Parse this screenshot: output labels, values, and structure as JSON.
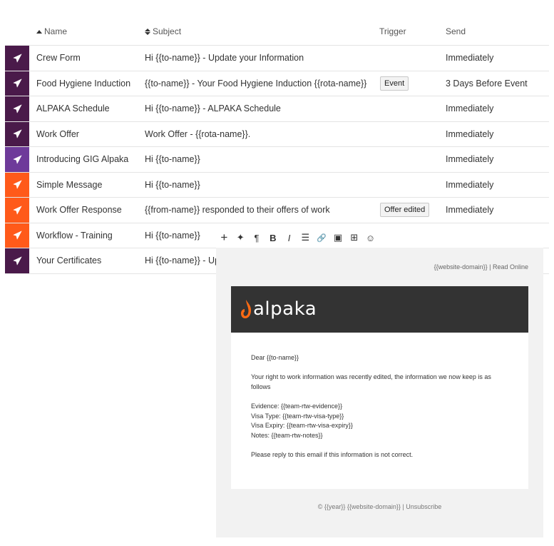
{
  "table": {
    "headers": {
      "name": "Name",
      "subject": "Subject",
      "trigger": "Trigger",
      "send": "Send"
    },
    "rows": [
      {
        "name": "Crew Form",
        "subject": "Hi {{to-name}} - Update your Information",
        "trigger": "",
        "send": "Immediately",
        "icon_color": "#4a1a4a"
      },
      {
        "name": "Food Hygiene Induction",
        "subject": "{{to-name}} - Your Food Hygiene Induction {{rota-name}}",
        "trigger": "Event",
        "send": "3 Days Before Event",
        "icon_color": "#4a1a4a"
      },
      {
        "name": "ALPAKA Schedule",
        "subject": "Hi {{to-name}} -  ALPAKA Schedule",
        "trigger": "",
        "send": "Immediately",
        "icon_color": "#4a1a4a"
      },
      {
        "name": "Work Offer",
        "subject": "Work Offer - {{rota-name}}.",
        "trigger": "",
        "send": "Immediately",
        "icon_color": "#4a1a4a"
      },
      {
        "name": "Introducing GIG Alpaka",
        "subject": "Hi {{to-name}}",
        "trigger": "",
        "send": "Immediately",
        "icon_color": "#6e3a9a"
      },
      {
        "name": "Simple Message",
        "subject": "Hi {{to-name}}",
        "trigger": "",
        "send": "Immediately",
        "icon_color": "#ff5a1a"
      },
      {
        "name": "Work Offer Response",
        "subject": "{{from-name}} responded to their offers of work",
        "trigger": "Offer edited",
        "send": "Immediately",
        "icon_color": "#ff5a1a"
      },
      {
        "name": "Workflow - Training",
        "subject": "Hi {{to-name}}",
        "trigger": "",
        "send": "",
        "icon_color": "#ff5a1a"
      },
      {
        "name": "Your Certificates",
        "subject": "Hi {{to-name}} - Up",
        "trigger": "",
        "send": "",
        "icon_color": "#4a1a4a"
      }
    ]
  },
  "toolbar": {
    "items": [
      {
        "name": "add-icon",
        "glyph": "+"
      },
      {
        "name": "sparkle-icon",
        "glyph": "✦"
      },
      {
        "name": "paragraph-icon",
        "glyph": "¶"
      },
      {
        "name": "bold-icon",
        "glyph": "B"
      },
      {
        "name": "italic-icon",
        "glyph": "I"
      },
      {
        "name": "list-icon",
        "glyph": "☰"
      },
      {
        "name": "link-icon",
        "glyph": "🔗"
      },
      {
        "name": "image-icon",
        "glyph": "▣"
      },
      {
        "name": "table-icon",
        "glyph": "⊞"
      },
      {
        "name": "emoji-icon",
        "glyph": "☺"
      }
    ]
  },
  "email": {
    "header_links": "{{website-domain}} | Read Online",
    "logo_text": "alpaka",
    "brand_color": "#ff6a13",
    "banner_color": "#333333",
    "greeting": "Dear {{to-name}}",
    "intro_line1": "Your right to work information was recently edited, the information we now keep is as",
    "intro_line2": "follows",
    "evidence": "Evidence: {{team-rtw-evidence}}",
    "visa_type": "Visa Type: {{team-rtw-visa-type}}",
    "visa_expiry": "Visa Expiry: {{team-rtw-visa-expiry}}",
    "notes": "Notes: {{team-rtw-notes}}",
    "closing": "Please reply to this email if this information is not correct.",
    "footer": "© {{year}} {{website-domain}} | Unsubscribe"
  }
}
